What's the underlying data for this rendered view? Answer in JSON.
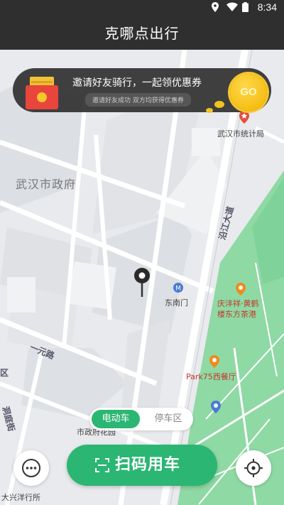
{
  "status_bar": {
    "time": "8:34",
    "icons": [
      "location-icon",
      "wifi-icon",
      "battery-icon"
    ]
  },
  "title_bar": {
    "title": "克哪点出行"
  },
  "promo_banner": {
    "title": "邀请好友骑行，一起领优惠券",
    "subtitle": "邀请好友成功 双方均获得优惠券",
    "go_label": "GO"
  },
  "map": {
    "labels": {
      "gov": "武汉市政府",
      "stats_bureau": "武汉市统计局",
      "yanjiang": "沿江大道",
      "dongnanmen": "东南门",
      "qingfeng": "庆沣祥·黄鹤",
      "qingfeng2": "楼东方茶港",
      "park75": "Park75西餐厅",
      "yiyuan": "一元路",
      "qu": "区",
      "hetang": "洞庭街",
      "park_cut": "市政府花园",
      "xingyang": "大兴洋行所"
    }
  },
  "mode_toggle": {
    "active": "电动车",
    "inactive": "停车区"
  },
  "actions": {
    "scan_label": "扫码用车"
  },
  "colors": {
    "accent": "#2bb673",
    "bar": "#2f2f2f",
    "park": "#7fd39a",
    "map_bg": "#e9ebee"
  }
}
